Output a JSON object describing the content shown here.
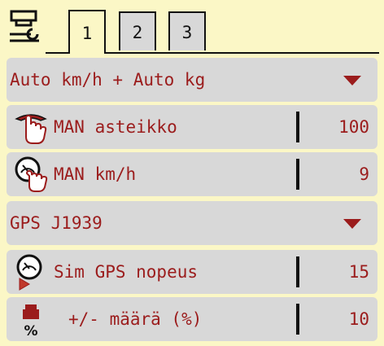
{
  "tabs": [
    {
      "label": "1",
      "active": true
    },
    {
      "label": "2",
      "active": false
    },
    {
      "label": "3",
      "active": false
    }
  ],
  "rows": [
    {
      "label": "Auto km/h + Auto kg",
      "type": "dropdown"
    },
    {
      "label": "MAN asteikko",
      "value": "100",
      "icon": "manual-scale-icon"
    },
    {
      "label": "MAN km/h",
      "value": "9",
      "icon": "manual-speed-icon"
    },
    {
      "label": "GPS J1939",
      "type": "dropdown"
    },
    {
      "label": "Sim GPS nopeus",
      "value": "15",
      "icon": "sim-gps-speed-icon"
    },
    {
      "label": "+/- määrä (%)",
      "value": "10",
      "icon": "quantity-percent-icon"
    }
  ],
  "colors": {
    "background": "#fbf7c6",
    "row": "#d8d8d8",
    "text": "#9b1c1c",
    "line": "#111111"
  }
}
